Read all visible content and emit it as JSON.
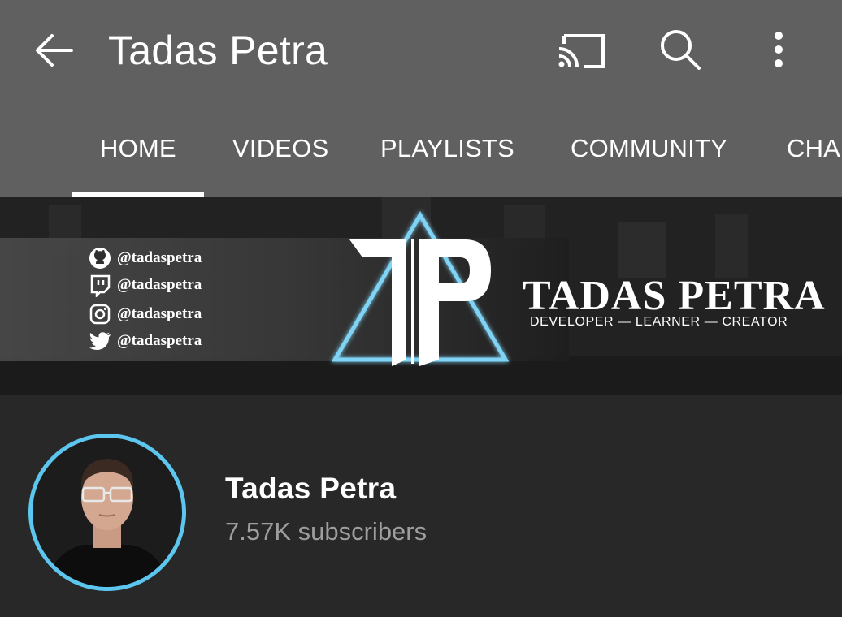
{
  "appbar": {
    "title": "Tadas Petra",
    "icons": [
      "back-arrow-icon",
      "cast-icon",
      "search-icon",
      "more-vertical-icon"
    ]
  },
  "tabs": [
    {
      "label": "HOME",
      "selected": true
    },
    {
      "label": "VIDEOS",
      "selected": false
    },
    {
      "label": "PLAYLISTS",
      "selected": false
    },
    {
      "label": "COMMUNITY",
      "selected": false
    },
    {
      "label": "CHA",
      "selected": false
    }
  ],
  "banner": {
    "socials": [
      {
        "icon": "github-icon",
        "handle": "@tadaspetra"
      },
      {
        "icon": "twitch-icon",
        "handle": "@tadaspetra"
      },
      {
        "icon": "instagram-icon",
        "handle": "@tadaspetra"
      },
      {
        "icon": "twitter-icon",
        "handle": "@tadaspetra"
      }
    ],
    "logo_text": "TP",
    "brand_name": "TADAS PETRA",
    "tagline": "DEVELOPER  —  LEARNER  —  CREATOR"
  },
  "channel": {
    "name": "Tadas Petra",
    "subscribers": "7.57K subscribers"
  },
  "colors": {
    "appbar_bg": "#606060",
    "page_bg": "#282828",
    "accent_glow": "#7fd3f5",
    "secondary_text": "#9e9e9e"
  }
}
